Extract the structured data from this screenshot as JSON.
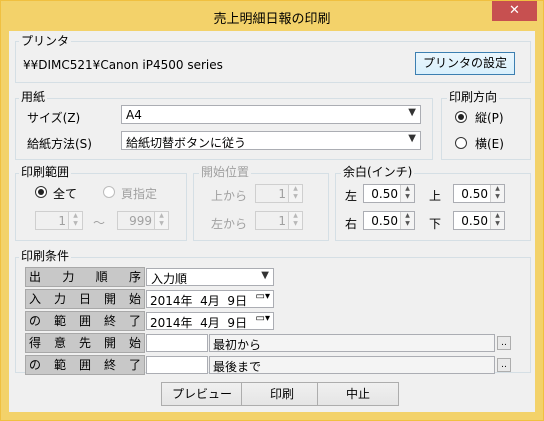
{
  "window": {
    "title": "売上明細日報の印刷",
    "close": "✕"
  },
  "printer": {
    "label": "プリンタ",
    "name": "¥¥DIMC521¥Canon iP4500 series",
    "settings_button": "プリンタの設定"
  },
  "paper": {
    "label": "用紙",
    "size_label": "サイズ(Z)",
    "size_value": "A4",
    "feed_label": "給紙方法(S)",
    "feed_value": "給紙切替ボタンに従う"
  },
  "orientation": {
    "label": "印刷方向",
    "portrait": "縦(P)",
    "landscape": "横(E)",
    "selected": "portrait"
  },
  "range": {
    "label": "印刷範囲",
    "all": "全て",
    "pages": "頁指定",
    "from": "1",
    "sep": "～",
    "to": "999",
    "selected": "all"
  },
  "start_position": {
    "label": "開始位置",
    "top_label": "上から",
    "top_value": "1",
    "left_label": "左から",
    "left_value": "1"
  },
  "margins": {
    "label": "余白(インチ)",
    "left_label": "左",
    "left": "0.50",
    "top_label": "上",
    "top": "0.50",
    "right_label": "右",
    "right": "0.50",
    "bottom_label": "下",
    "bottom": "0.50"
  },
  "conditions": {
    "label": "印刷条件",
    "order_label": [
      "出",
      "力",
      "順",
      "序"
    ],
    "order_value": "入力順",
    "date_start_label": [
      "入",
      "力",
      "日",
      "開",
      "始"
    ],
    "date_start": "2014年  4月  9日",
    "date_end_label": [
      "の",
      "範",
      "囲",
      "終",
      "了"
    ],
    "date_end": "2014年  4月  9日",
    "cust_start_label": [
      "得",
      "意",
      "先",
      "開",
      "始"
    ],
    "cust_start": "最初から",
    "cust_end_label": [
      "の",
      "範",
      "囲",
      "終",
      "了"
    ],
    "cust_end": "最後まで",
    "browse": ".."
  },
  "buttons": {
    "preview": "プレビュー",
    "print": "印刷",
    "cancel": "中止"
  }
}
